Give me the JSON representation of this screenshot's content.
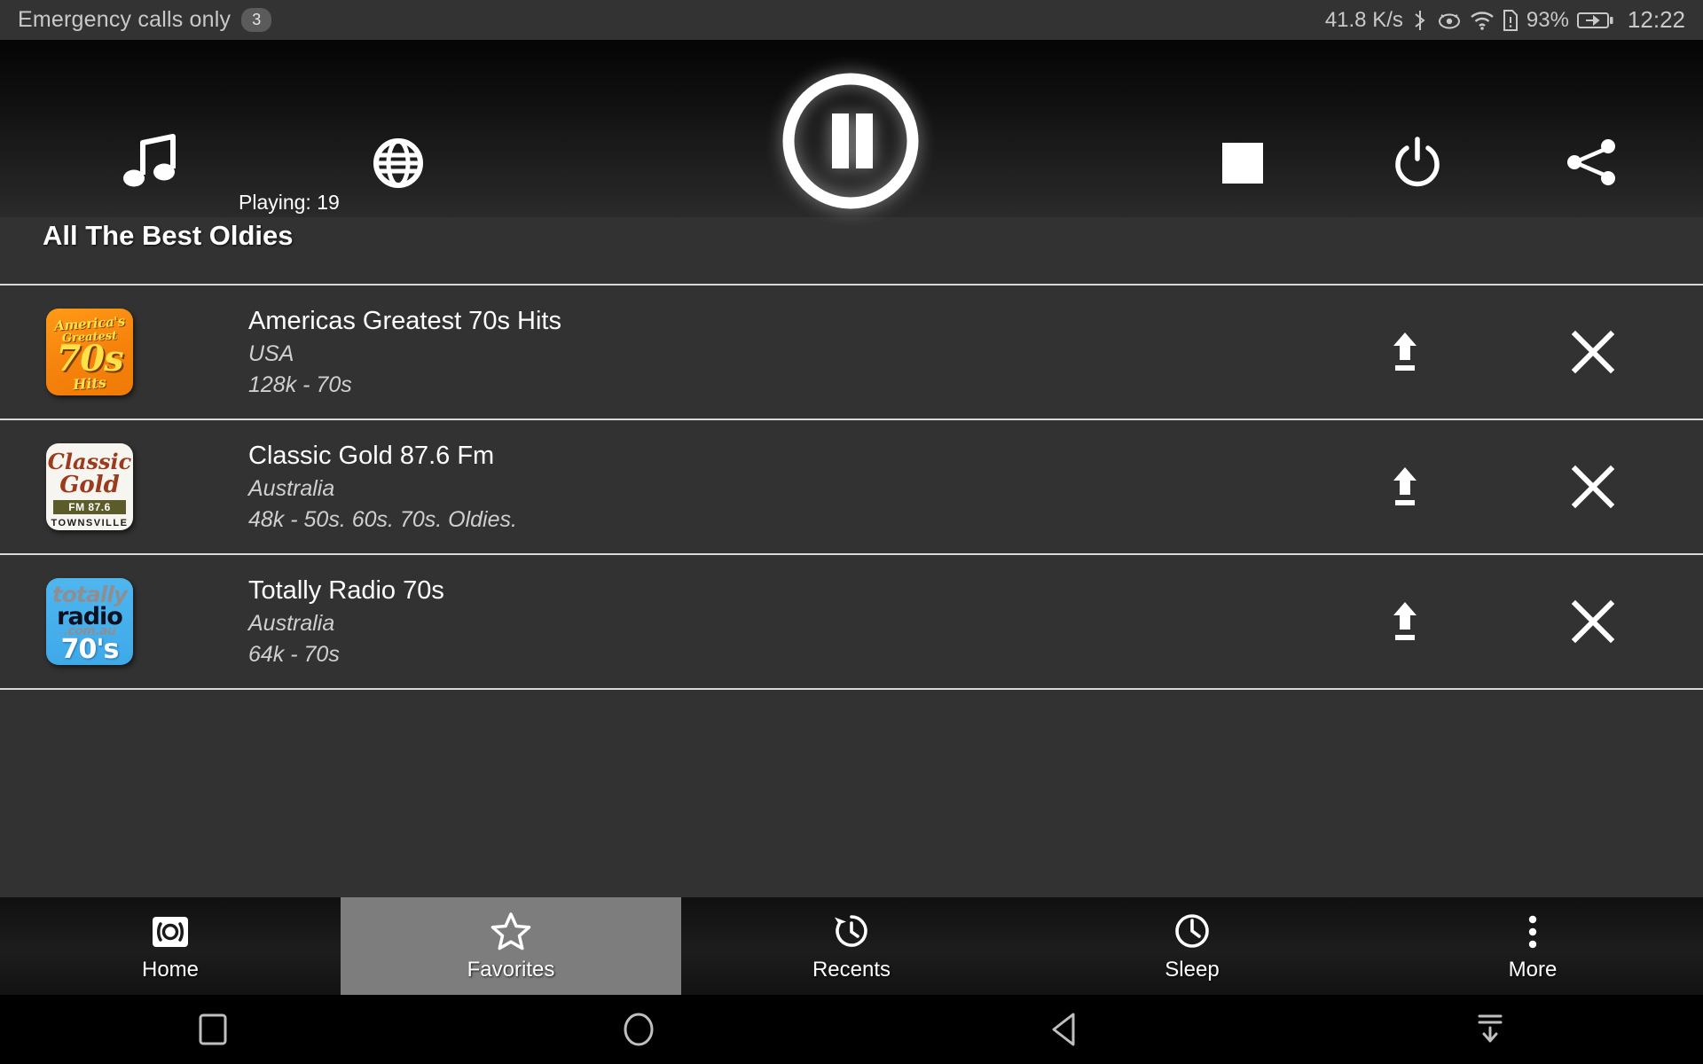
{
  "statusbar": {
    "carrier": "Emergency calls only",
    "badge": "3",
    "network_speed": "41.8 K/s",
    "battery_pct": "93%",
    "time": "12:22",
    "icons": [
      "bluetooth-icon",
      "eye-icon",
      "wifi-icon",
      "sim-alert-icon",
      "battery-charging-icon"
    ]
  },
  "player": {
    "music_icon": "music-note-icon",
    "globe_icon": "globe-icon",
    "playing_label": "Playing: 19",
    "transport_state": "pause-icon",
    "stop_icon": "stop-icon",
    "power_icon": "power-icon",
    "share_icon": "share-icon"
  },
  "section": {
    "title": "All The Best Oldies"
  },
  "stations": [
    {
      "name": "Americas Greatest 70s Hits",
      "country": "USA",
      "meta": "128k - 70s",
      "logo": {
        "kind": "logo-a",
        "line1": "America's",
        "line2": "Greatest",
        "line3": "70s",
        "line4": "Hits"
      },
      "actions": {
        "move_top": "move-to-top-icon",
        "remove": "remove-icon"
      }
    },
    {
      "name": "Classic Gold 87.6 Fm",
      "country": "Australia",
      "meta": "48k - 50s. 60s. 70s. Oldies.",
      "logo": {
        "kind": "logo-b",
        "line1": "Classic",
        "line2": "Gold",
        "line3": "FM 87.6",
        "line4": "TOWNSVILLE"
      },
      "actions": {
        "move_top": "move-to-top-icon",
        "remove": "remove-icon"
      }
    },
    {
      "name": "Totally Radio 70s",
      "country": "Australia",
      "meta": "64k - 70s",
      "logo": {
        "kind": "logo-c",
        "line1": "totally",
        "line2": "radio",
        "line3": ".com.au",
        "line4": "70's"
      },
      "actions": {
        "move_top": "move-to-top-icon",
        "remove": "remove-icon"
      }
    }
  ],
  "tabs": [
    {
      "label": "Home",
      "icon": "broadcast-icon",
      "active": false
    },
    {
      "label": "Favorites",
      "icon": "star-icon",
      "active": true
    },
    {
      "label": "Recents",
      "icon": "history-icon",
      "active": false
    },
    {
      "label": "Sleep",
      "icon": "clock-icon",
      "active": false
    },
    {
      "label": "More",
      "icon": "overflow-icon",
      "active": false
    }
  ],
  "navbar": {
    "buttons": [
      "recents-square-icon",
      "home-circle-icon",
      "back-triangle-icon",
      "hide-keyboard-icon"
    ]
  },
  "colors": {
    "background": "#323232",
    "header_top": "#050505",
    "divider": "#d8d8d8",
    "active_tab": "#7d7d7d",
    "accent_text": "#ffffff"
  }
}
